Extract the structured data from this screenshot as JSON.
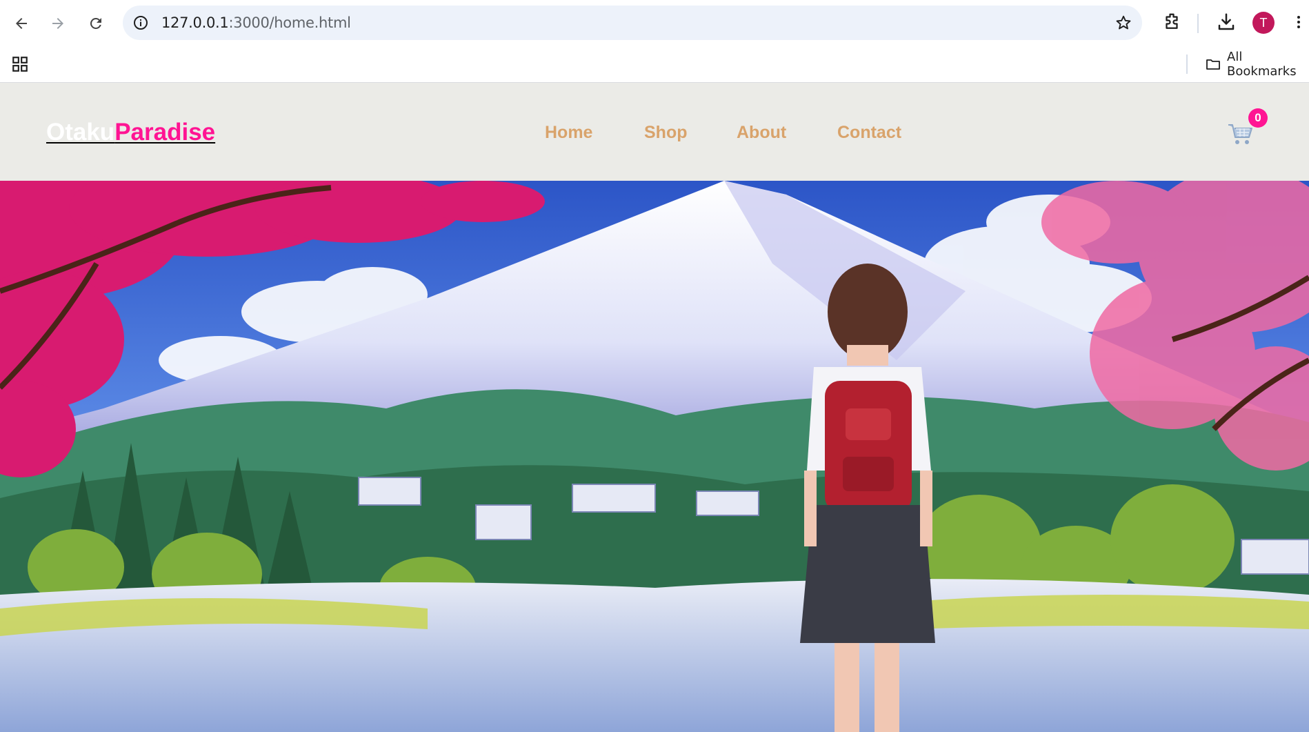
{
  "browser": {
    "url_host": "127.0.0.1",
    "url_rest": ":3000/home.html",
    "profile_initial": "T",
    "bookmarks_label": "All Bookmarks",
    "icons": [
      "back-arrow-icon",
      "forward-arrow-icon",
      "reload-icon",
      "info-icon",
      "star-icon",
      "extensions-icon",
      "download-icon",
      "menu-dots-icon",
      "apps-grid-icon",
      "folder-icon"
    ]
  },
  "site": {
    "logo_part1": "Otaku",
    "logo_part2": "Paradise",
    "nav": [
      "Home",
      "Shop",
      "About",
      "Contact"
    ],
    "cart_count": "0",
    "colors": {
      "accent": "#ff1493",
      "nav": "#d9a36b",
      "header_bg": "#ebebe7"
    }
  },
  "hero": {
    "description_icon": "hero-illustration"
  }
}
